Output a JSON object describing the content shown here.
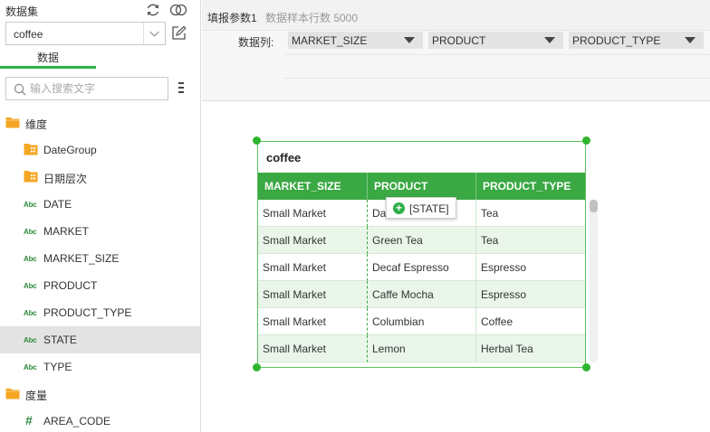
{
  "left_panel": {
    "dataset_title": "数据集",
    "dataset_select_value": "coffee",
    "data_tab": "数据",
    "search_placeholder": "输入搜索文字",
    "tree": [
      {
        "label": "维度",
        "kind": "folder",
        "indent": 0
      },
      {
        "label": "DateGroup",
        "kind": "folder-group",
        "indent": 1
      },
      {
        "label": "日期层次",
        "kind": "folder-group",
        "indent": 1
      },
      {
        "label": "DATE",
        "kind": "abc",
        "indent": 1
      },
      {
        "label": "MARKET",
        "kind": "abc",
        "indent": 1
      },
      {
        "label": "MARKET_SIZE",
        "kind": "abc",
        "indent": 1
      },
      {
        "label": "PRODUCT",
        "kind": "abc",
        "indent": 1
      },
      {
        "label": "PRODUCT_TYPE",
        "kind": "abc",
        "indent": 1
      },
      {
        "label": "STATE",
        "kind": "abc",
        "indent": 1,
        "selected": true
      },
      {
        "label": "TYPE",
        "kind": "abc",
        "indent": 1
      },
      {
        "label": "度量",
        "kind": "folder",
        "indent": 0
      },
      {
        "label": "AREA_CODE",
        "kind": "hash",
        "indent": 1
      }
    ],
    "abc_text": "Abc",
    "hash_text": "#"
  },
  "top_bar": {
    "param_name": "填报参数1",
    "sample_rows": "数据样本行数 5000"
  },
  "columns_bar": {
    "label": "数据列:",
    "selects": [
      "MARKET_SIZE",
      "PRODUCT",
      "PRODUCT_TYPE"
    ]
  },
  "widget": {
    "title": "coffee",
    "headers": [
      "MARKET_SIZE",
      "PRODUCT",
      "PRODUCT_TYPE"
    ],
    "rows": [
      [
        "Small Market",
        "Da",
        "Tea"
      ],
      [
        "Small Market",
        "Green Tea",
        "Tea"
      ],
      [
        "Small Market",
        "Decaf Espresso",
        "Espresso"
      ],
      [
        "Small Market",
        "Caffe Mocha",
        "Espresso"
      ],
      [
        "Small Market",
        "Columbian",
        "Coffee"
      ],
      [
        "Small Market",
        "Lemon",
        "Herbal Tea"
      ]
    ]
  },
  "drag_tip": {
    "text": "[STATE]",
    "icon": "+"
  },
  "colors": {
    "accent": "#2daf4a",
    "header_bg": "#3aa843",
    "row_alt_bg": "#eaf6ea",
    "folder": "#f5a623"
  }
}
